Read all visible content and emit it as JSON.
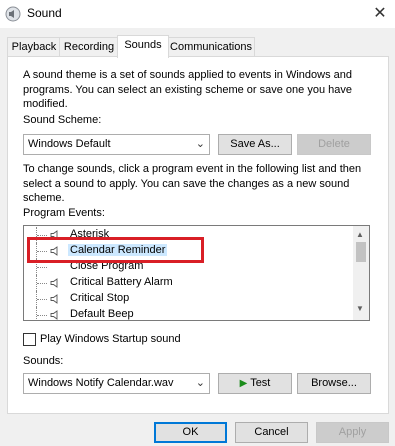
{
  "window": {
    "title": "Sound",
    "close_glyph": "✕"
  },
  "tabs": [
    {
      "label": "Playback"
    },
    {
      "label": "Recording"
    },
    {
      "label": "Sounds"
    },
    {
      "label": "Communications"
    }
  ],
  "sounds_tab": {
    "description": "A sound theme is a set of sounds applied to events in Windows and programs.  You can select an existing scheme or save one you have modified.",
    "scheme_label": "Sound Scheme:",
    "scheme_value": "Windows Default",
    "save_as_label": "Save As...",
    "delete_label": "Delete",
    "instructions": "To change sounds, click a program event in the following list and then select a sound to apply.  You can save the changes as a new sound scheme.",
    "program_events_label": "Program Events:",
    "events": [
      {
        "name": "Asterisk"
      },
      {
        "name": "Calendar Reminder",
        "selected": true
      },
      {
        "name": "Close Program"
      },
      {
        "name": "Critical Battery Alarm"
      },
      {
        "name": "Critical Stop"
      },
      {
        "name": "Default Beep"
      }
    ],
    "startup_checkbox_label": "Play Windows Startup sound",
    "startup_checked": false,
    "sounds_label": "Sounds:",
    "sound_value": "Windows Notify Calendar.wav",
    "test_label": "Test",
    "browse_label": "Browse..."
  },
  "footer": {
    "ok_label": "OK",
    "cancel_label": "Cancel",
    "apply_label": "Apply"
  },
  "colors": {
    "highlight_box": "#d91f26",
    "selection": "#cce8ff",
    "ok_border": "#0078d7",
    "play_icon": "#1a8c1a"
  }
}
